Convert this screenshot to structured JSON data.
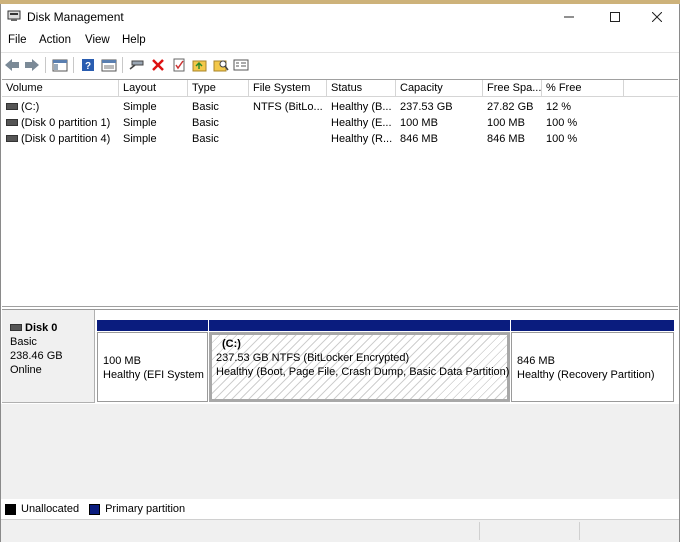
{
  "window": {
    "title": "Disk Management",
    "controls": [
      "minimize",
      "maximize",
      "close"
    ]
  },
  "menu": {
    "items": [
      "File",
      "Action",
      "View",
      "Help"
    ]
  },
  "toolbar": {
    "icons": [
      "back-icon",
      "forward-icon",
      "show-hide-console-tree-icon",
      "help-icon",
      "properties-icon",
      "connect-icon",
      "delete-icon",
      "check-icon",
      "open-folder-icon",
      "search-icon",
      "settings-icon"
    ]
  },
  "volume_list": {
    "columns": [
      "Volume",
      "Layout",
      "Type",
      "File System",
      "Status",
      "Capacity",
      "Free Spa...",
      "% Free"
    ],
    "rows": [
      {
        "volume": "(C:)",
        "layout": "Simple",
        "type": "Basic",
        "fs": "NTFS (BitLo...",
        "status": "Healthy (B...",
        "capacity": "237.53 GB",
        "free": "27.82 GB",
        "pct": "12 %"
      },
      {
        "volume": "(Disk 0 partition 1)",
        "layout": "Simple",
        "type": "Basic",
        "fs": "",
        "status": "Healthy (E...",
        "capacity": "100 MB",
        "free": "100 MB",
        "pct": "100 %"
      },
      {
        "volume": "(Disk 0 partition 4)",
        "layout": "Simple",
        "type": "Basic",
        "fs": "",
        "status": "Healthy (R...",
        "capacity": "846 MB",
        "free": "846 MB",
        "pct": "100 %"
      }
    ]
  },
  "disk0": {
    "name": "Disk 0",
    "type": "Basic",
    "size": "238.46 GB",
    "state": "Online",
    "partitions": [
      {
        "line1": "100 MB",
        "line2": "Healthy (EFI System"
      },
      {
        "letter": "(C:)",
        "line1": "237.53 GB NTFS (BitLocker Encrypted)",
        "line2": "Healthy (Boot, Page File, Crash Dump, Basic Data Partition)"
      },
      {
        "line1": "846 MB",
        "line2": "Healthy (Recovery Partition)"
      }
    ]
  },
  "legend": {
    "unallocated": "Unallocated",
    "primary": "Primary partition",
    "unallocated_color": "#000000",
    "primary_color": "#0a1c7e"
  }
}
